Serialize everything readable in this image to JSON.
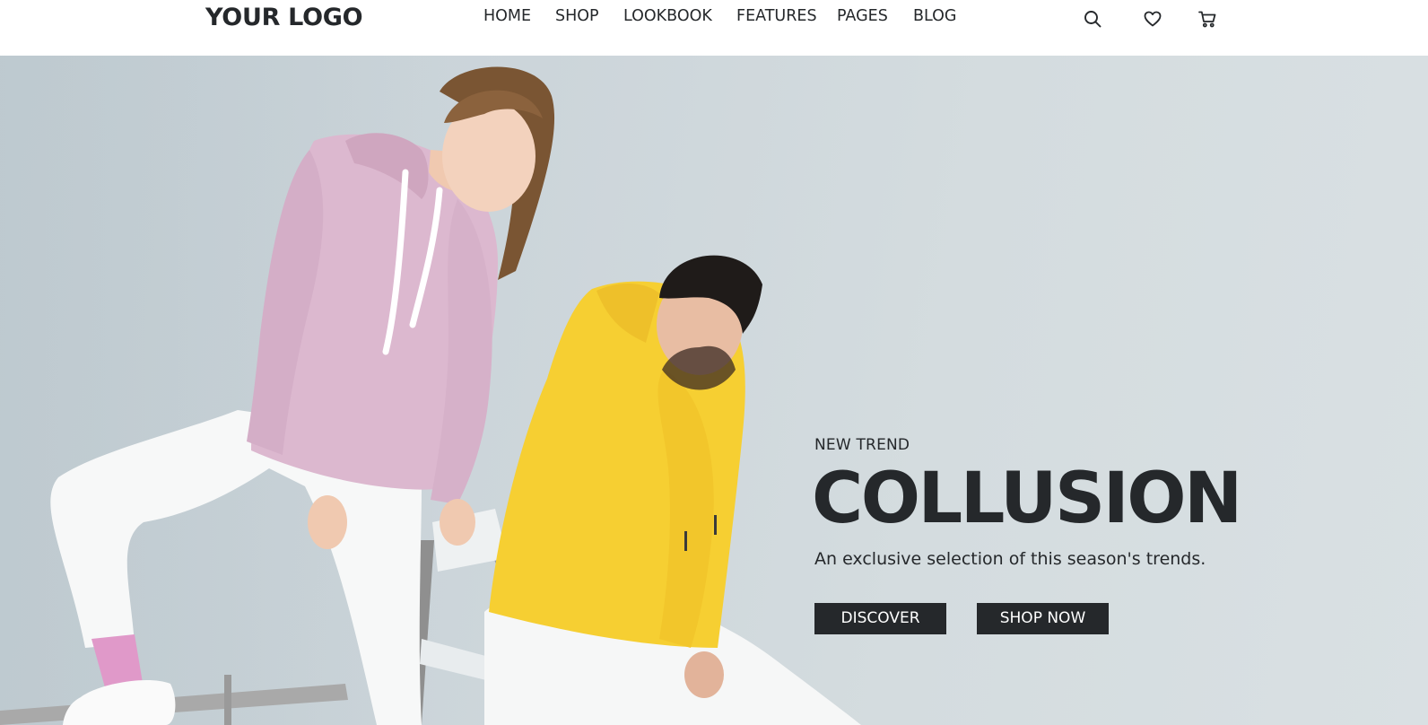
{
  "header": {
    "logo": "YOUR LOGO",
    "nav": [
      {
        "label": "HOME"
      },
      {
        "label": "SHOP"
      },
      {
        "label": "LOOKBOOK"
      },
      {
        "label": "FEATURES"
      },
      {
        "label": "PAGES"
      },
      {
        "label": "BLOG"
      }
    ],
    "icons": [
      "search-icon",
      "heart-icon",
      "cart-icon"
    ]
  },
  "hero": {
    "eyebrow": "NEW TREND",
    "headline": "COLLUSION",
    "subtitle": "An exclusive selection of this season's trends.",
    "buttons": {
      "discover": "DISCOVER",
      "shop_now": "SHOP NOW"
    }
  },
  "colors": {
    "text_dark": "#25282b",
    "button_bg": "#25282b",
    "button_text": "#ffffff",
    "hero_bg": "#cdd6db",
    "pink_hoodie": "#dcb8cf",
    "yellow_hoodie": "#f6cf32"
  }
}
